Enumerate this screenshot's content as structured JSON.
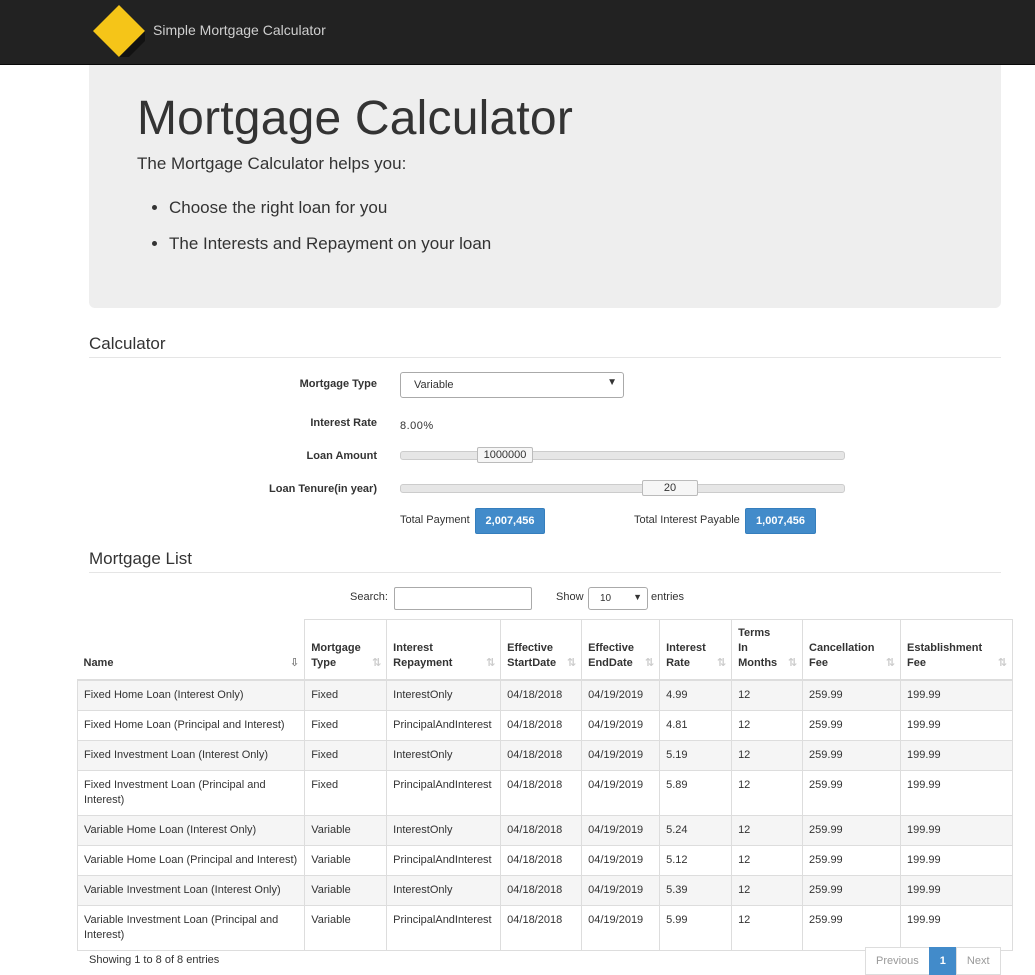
{
  "navbar": {
    "brand": "Simple Mortgage Calculator",
    "logo_icon": "diamond-logo-icon",
    "logo_color": "#f5c518"
  },
  "jumbotron": {
    "title": "Mortgage Calculator",
    "lead": "The Mortgage Calculator helps you:",
    "bullets": [
      "Choose the right loan for you",
      "The Interests and Repayment on your loan"
    ]
  },
  "calculator": {
    "heading": "Calculator",
    "mortgage_type_label": "Mortgage Type",
    "mortgage_type_value": "Variable",
    "interest_rate_label": "Interest Rate",
    "interest_rate_value": "8.00%",
    "loan_amount_label": "Loan Amount",
    "loan_amount_value": "1000000",
    "loan_tenure_label": "Loan Tenure(in year)",
    "loan_tenure_value": "20",
    "total_payment_label": "Total Payment",
    "total_payment_value": "2,007,456",
    "total_interest_label": "Total Interest Payable",
    "total_interest_value": "1,007,456"
  },
  "list": {
    "heading": "Mortgage List",
    "search_label": "Search:",
    "show_label": "Show",
    "show_value": "10",
    "entries_label": "entries",
    "columns": [
      [
        "Name"
      ],
      [
        "Mortgage",
        "Type"
      ],
      [
        "Interest",
        "Repayment"
      ],
      [
        "Effective",
        "StartDate"
      ],
      [
        "Effective",
        "EndDate"
      ],
      [
        "Interest",
        "Rate"
      ],
      [
        "Terms",
        "In",
        "Months"
      ],
      [
        "Cancellation",
        "Fee"
      ],
      [
        "Establishment",
        "Fee"
      ]
    ],
    "rows": [
      [
        "Fixed Home Loan (Interest Only)",
        "Fixed",
        "InterestOnly",
        "04/18/2018",
        "04/19/2019",
        "4.99",
        "12",
        "259.99",
        "199.99"
      ],
      [
        "Fixed Home Loan (Principal and Interest)",
        "Fixed",
        "PrincipalAndInterest",
        "04/18/2018",
        "04/19/2019",
        "4.81",
        "12",
        "259.99",
        "199.99"
      ],
      [
        "Fixed Investment Loan (Interest Only)",
        "Fixed",
        "InterestOnly",
        "04/18/2018",
        "04/19/2019",
        "5.19",
        "12",
        "259.99",
        "199.99"
      ],
      [
        "Fixed Investment Loan (Principal and Interest)",
        "Fixed",
        "PrincipalAndInterest",
        "04/18/2018",
        "04/19/2019",
        "5.89",
        "12",
        "259.99",
        "199.99"
      ],
      [
        "Variable Home Loan (Interest Only)",
        "Variable",
        "InterestOnly",
        "04/18/2018",
        "04/19/2019",
        "5.24",
        "12",
        "259.99",
        "199.99"
      ],
      [
        "Variable Home Loan (Principal and Interest)",
        "Variable",
        "PrincipalAndInterest",
        "04/18/2018",
        "04/19/2019",
        "5.12",
        "12",
        "259.99",
        "199.99"
      ],
      [
        "Variable Investment Loan (Interest Only)",
        "Variable",
        "InterestOnly",
        "04/18/2018",
        "04/19/2019",
        "5.39",
        "12",
        "259.99",
        "199.99"
      ],
      [
        "Variable Investment Loan (Principal and Interest)",
        "Variable",
        "PrincipalAndInterest",
        "04/18/2018",
        "04/19/2019",
        "5.99",
        "12",
        "259.99",
        "199.99"
      ]
    ],
    "info": "Showing 1 to 8 of 8 entries",
    "pagination": {
      "previous": "Previous",
      "current": "1",
      "next": "Next"
    }
  }
}
